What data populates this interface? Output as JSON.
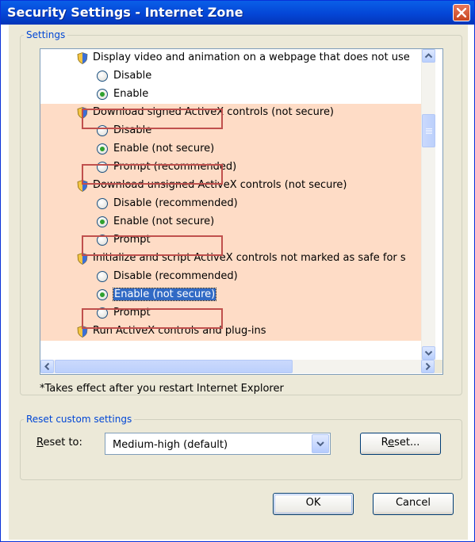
{
  "window": {
    "title": "Security Settings - Internet Zone"
  },
  "settings": {
    "legend": "Settings",
    "items": [
      {
        "type": "category",
        "label": "Display video and animation on a webpage that does not use"
      },
      {
        "type": "option",
        "label": "Disable",
        "checked": false
      },
      {
        "type": "option",
        "label": "Enable",
        "checked": true
      },
      {
        "type": "category",
        "label": "Download signed ActiveX controls (not secure)"
      },
      {
        "type": "option",
        "label": "Disable",
        "checked": false
      },
      {
        "type": "option",
        "label": "Enable (not secure)",
        "checked": true
      },
      {
        "type": "option",
        "label": "Prompt (recommended)",
        "checked": false
      },
      {
        "type": "category",
        "label": "Download unsigned ActiveX controls (not secure)"
      },
      {
        "type": "option",
        "label": "Disable (recommended)",
        "checked": false
      },
      {
        "type": "option",
        "label": "Enable (not secure)",
        "checked": true
      },
      {
        "type": "option",
        "label": "Prompt",
        "checked": false
      },
      {
        "type": "category",
        "label": "Initialize and script ActiveX controls not marked as safe for s"
      },
      {
        "type": "option",
        "label": "Disable (recommended)",
        "checked": false
      },
      {
        "type": "option",
        "label": "Enable (not secure)",
        "checked": true
      },
      {
        "type": "option",
        "label": "Prompt",
        "checked": false
      },
      {
        "type": "category",
        "label": "Run ActiveX controls and plug-ins"
      }
    ],
    "note": "*Takes effect after you restart Internet Explorer"
  },
  "reset": {
    "legend": "Reset custom settings",
    "label_pre": "",
    "label_accel": "R",
    "label_post": "eset to:",
    "selected": "Medium-high (default)",
    "button_pre": "R",
    "button_accel": "e",
    "button_post": "set..."
  },
  "footer": {
    "ok_label": "OK",
    "cancel_label": "Cancel"
  },
  "colors": {
    "highlight_rows": "#fedcc6",
    "annotation_box": "#c0504d",
    "titlebar": "#0446d6"
  },
  "icons": {
    "category_icon": "shield-icon",
    "close": "close-icon"
  }
}
